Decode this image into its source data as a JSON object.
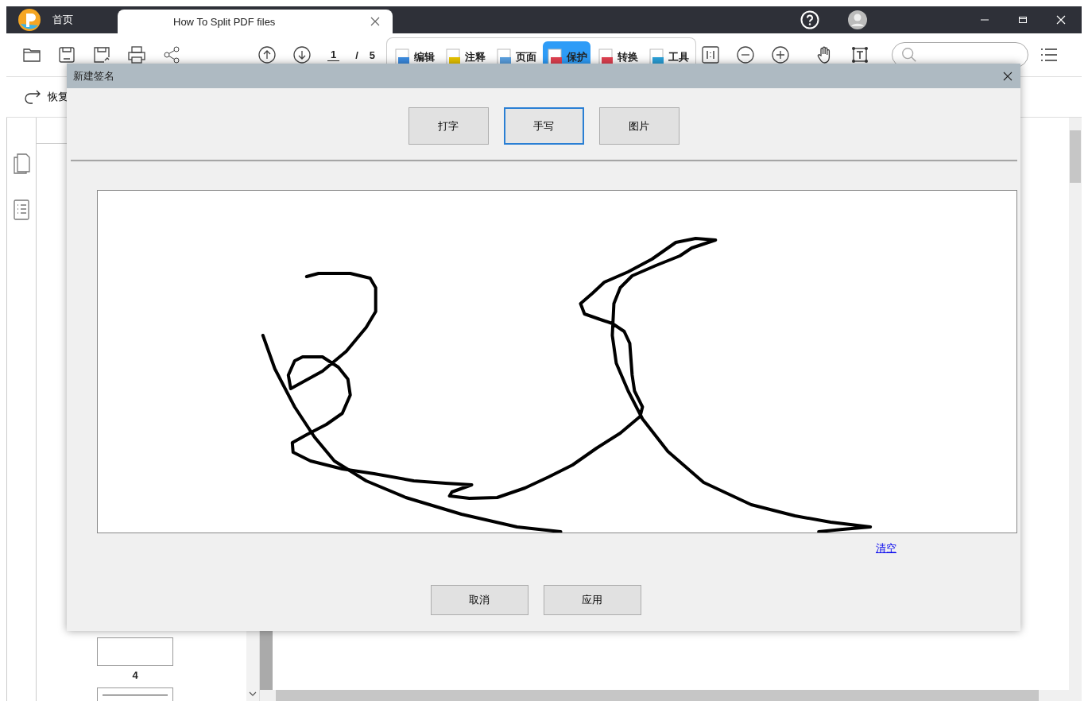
{
  "title_bar": {
    "tabs": [
      {
        "label": "首页",
        "selected": false
      },
      {
        "label": "How To Split PDF files",
        "selected": true
      }
    ]
  },
  "toolbar": {
    "current_page": "1",
    "separator": "/",
    "total_pages": "5",
    "ribbon_tabs": [
      {
        "label": "编辑",
        "selected": false
      },
      {
        "label": "注释",
        "selected": false
      },
      {
        "label": "页面",
        "selected": false
      },
      {
        "label": "保护",
        "selected": true
      },
      {
        "label": "转换",
        "selected": false
      },
      {
        "label": "工具",
        "selected": false
      }
    ]
  },
  "sub_toolbar": {
    "redo_label": "恢复"
  },
  "thumbnails": [
    {
      "label": "4"
    }
  ],
  "dialog": {
    "title": "新建签名",
    "mode_tabs": [
      {
        "label": "打字",
        "selected": false
      },
      {
        "label": "手写",
        "selected": true
      },
      {
        "label": "图片",
        "selected": false
      }
    ],
    "clear_link": "清空",
    "buttons": [
      "取消",
      "应用"
    ]
  }
}
